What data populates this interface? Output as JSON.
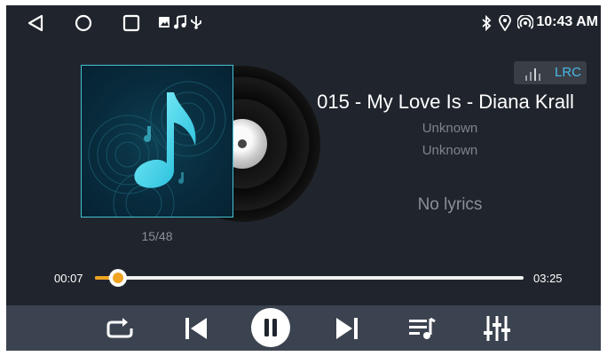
{
  "status_bar": {
    "time": "10:43 AM",
    "nav_icons": [
      "back-triangle-icon",
      "home-circle-icon",
      "recents-square-icon"
    ],
    "notification_icons": [
      "image-icon",
      "music-note-icon",
      "usb-icon"
    ],
    "system_icons": [
      "bluetooth-icon",
      "location-icon",
      "hotspot-icon"
    ]
  },
  "player": {
    "track_counter": "15/48",
    "lrc_label": "LRC",
    "song_title": "015 - My Love Is - Diana Krall",
    "artist": "Unknown",
    "album": "Unknown",
    "lyrics_placeholder": "No lyrics",
    "progress": {
      "elapsed": "00:07",
      "total": "03:25",
      "fraction": 0.034
    },
    "colors": {
      "accent": "#f0a420",
      "lrc": "#4bb8e8",
      "background": "#20252d",
      "controls_bar": "#3c4350"
    }
  },
  "controls": [
    "repeat-icon",
    "previous-icon",
    "pause-icon",
    "next-icon",
    "playlist-icon",
    "equalizer-icon"
  ]
}
